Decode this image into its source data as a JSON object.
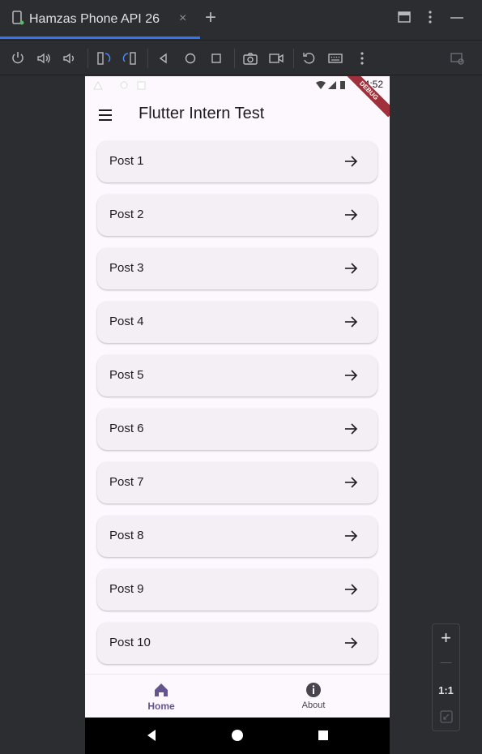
{
  "tab": {
    "title": "Hamzas Phone API 26",
    "close": "×",
    "add": "+"
  },
  "toolbar": {
    "buttons": [
      "power-icon",
      "volume-up-icon",
      "volume-down-icon",
      "rotate-left-icon",
      "rotate-right-icon",
      "back-icon",
      "home-icon",
      "overview-icon",
      "camera-icon",
      "video-icon",
      "reset-icon",
      "keyboard-icon",
      "more-icon"
    ]
  },
  "phone": {
    "status_time": "4:52",
    "debug_label": "DEBUG",
    "app_title": "Flutter Intern Test",
    "posts": [
      "Post 1",
      "Post 2",
      "Post 3",
      "Post 4",
      "Post 5",
      "Post 6",
      "Post 7",
      "Post 8",
      "Post 9",
      "Post 10"
    ],
    "nav": {
      "home": "Home",
      "about": "About"
    },
    "colors": {
      "accent": "#65558f",
      "background": "#fdf7fe",
      "card": "#f4eff4"
    }
  },
  "zoom": {
    "plus": "+",
    "minus": "—",
    "ratio": "1:1"
  }
}
